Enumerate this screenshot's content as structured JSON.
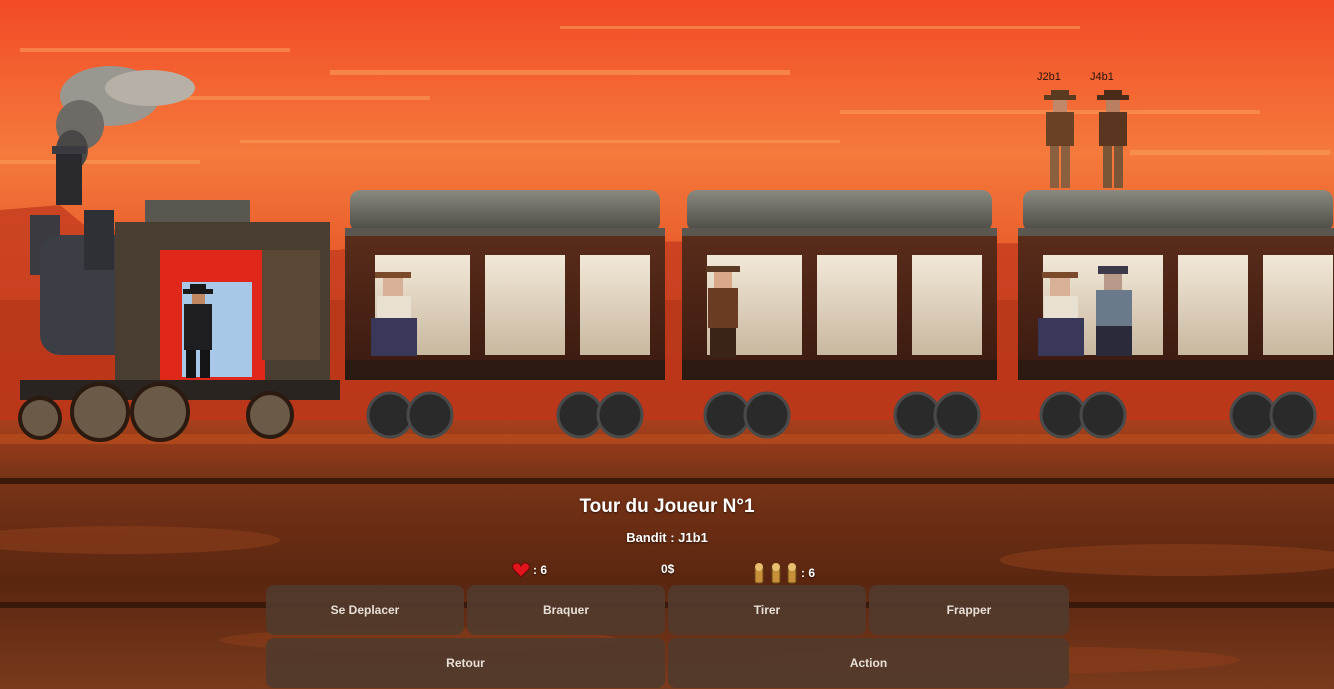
{
  "bandit_labels": {
    "left": "J2b1",
    "right": "J4b1"
  },
  "hud": {
    "turn_title": "Tour du Joueur N°1",
    "bandit_line": "Bandit : J1b1",
    "health": ": 6",
    "money": "0$",
    "bullets": ": 6"
  },
  "actions": {
    "move": "Se Deplacer",
    "rob": "Braquer",
    "shoot": "Tirer",
    "punch": "Frapper",
    "back": "Retour",
    "action": "Action"
  },
  "icons": {
    "health": "heart-icon",
    "bullets": "bullets-icon"
  },
  "colors": {
    "sky_top": "#f4522a",
    "sky_mid": "#f5823f",
    "ground": "#5a2a12",
    "button_bg": "#523a2c"
  }
}
